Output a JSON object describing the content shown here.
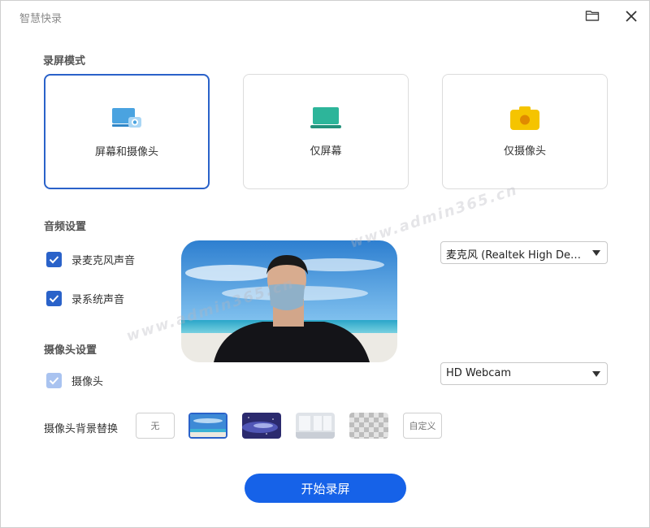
{
  "window": {
    "title": "智慧快录"
  },
  "mode": {
    "section_title": "录屏模式",
    "options": [
      {
        "label": "屏幕和摄像头",
        "icon": "screen-camera-icon",
        "selected": true
      },
      {
        "label": "仅屏幕",
        "icon": "laptop-icon",
        "selected": false
      },
      {
        "label": "仅摄像头",
        "icon": "camera-icon",
        "selected": false
      }
    ]
  },
  "audio": {
    "section_title": "音频设置",
    "mic_label": "录麦克风声音",
    "mic_checked": true,
    "system_label": "录系统声音",
    "system_checked": true,
    "mic_device": "麦克风 (Realtek High Definition Audio)"
  },
  "camera": {
    "section_title": "摄像头设置",
    "camera_label": "摄像头",
    "camera_checked": true,
    "camera_device": "HD Webcam",
    "bg_label": "摄像头背景替换",
    "bg_none": "无",
    "bg_custom": "自定义"
  },
  "actions": {
    "start_label": "开始录屏"
  },
  "watermark": "www.admin365.cn",
  "colors": {
    "accent": "#2a62c9",
    "button": "#1662e8",
    "laptop": "#2db59a",
    "camera": "#f5c400",
    "screen": "#4aa3e0"
  }
}
